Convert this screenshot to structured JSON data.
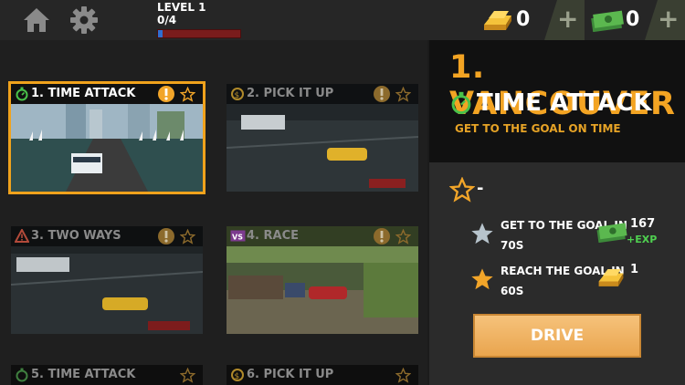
{
  "topbar": {
    "level_title": "LEVEL 1",
    "level_progress_text": "0/4",
    "level_progress_fraction": 0.06,
    "gold_value": "0",
    "cash_value": "0",
    "plus_label": "+"
  },
  "missions": [
    {
      "title": "1. TIME ATTACK",
      "mode_icon": "stopwatch-icon",
      "selected": true,
      "alert": true
    },
    {
      "title": "2. PICK IT UP",
      "mode_icon": "pickup-icon",
      "selected": false,
      "alert": true
    },
    {
      "title": "3. TWO WAYS",
      "mode_icon": "warning-icon",
      "selected": false,
      "alert": true
    },
    {
      "title": "4. RACE",
      "mode_icon": "vs-icon",
      "selected": false,
      "alert": true
    },
    {
      "title": "5. TIME ATTACK",
      "mode_icon": "stopwatch-icon",
      "selected": false,
      "alert": false
    },
    {
      "title": "6. PICK IT UP",
      "mode_icon": "pickup-icon",
      "selected": false,
      "alert": false
    }
  ],
  "detail": {
    "city_title": "1. VANCOUVER",
    "mode_title": "TIME ATTACK",
    "description": "GET TO THE GOAL ON TIME",
    "best_value": "-",
    "objectives": [
      {
        "line1": "GET TO THE GOAL IN",
        "line2": "70S",
        "reward_value": "167",
        "reward_extra": "+EXP",
        "reward_icon": "cash-icon"
      },
      {
        "line1": "REACH THE GOAL IN",
        "line2": "60S",
        "reward_value": "1",
        "reward_extra": "",
        "reward_icon": "gold-bar-icon"
      }
    ],
    "drive_label": "DRIVE"
  },
  "colors": {
    "accent": "#f3a423",
    "panel_dark": "#111111",
    "panel_mid": "#2b2b2b",
    "progress_fill": "#2f6fd1",
    "progress_track": "#7a1c1c"
  }
}
